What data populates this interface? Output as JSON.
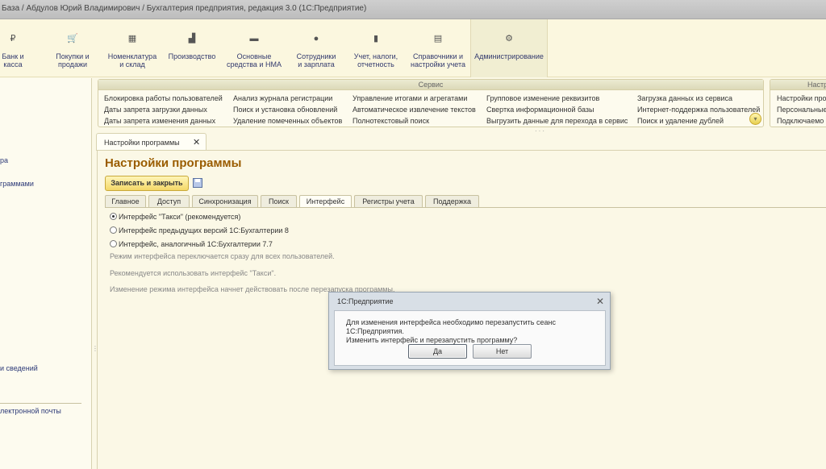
{
  "window": {
    "title": "База / Абдулов Юрий Владимирович / Бухгалтерия предприятия, редакция 3.0  (1С:Предприятие)"
  },
  "sections": [
    {
      "name": "bank",
      "line1": "Банк и",
      "line2": "касса",
      "icon": "ruble-icon",
      "glyph": "₽"
    },
    {
      "name": "purchases",
      "line1": "Покупки и",
      "line2": "продажи",
      "icon": "cart-icon",
      "glyph": "🛒"
    },
    {
      "name": "nomenclature",
      "line1": "Номенклатура",
      "line2": "и склад",
      "icon": "grid-icon",
      "glyph": "▦"
    },
    {
      "name": "production",
      "line1": "Производство",
      "line2": "",
      "icon": "factory-icon",
      "glyph": "▟"
    },
    {
      "name": "assets",
      "line1": "Основные",
      "line2": "средства и НМА",
      "icon": "truck-icon",
      "glyph": "▬"
    },
    {
      "name": "staff",
      "line1": "Сотрудники",
      "line2": "и зарплата",
      "icon": "person-icon",
      "glyph": "●"
    },
    {
      "name": "accounting",
      "line1": "Учет, налоги,",
      "line2": "отчетность",
      "icon": "chart-icon",
      "glyph": "▮"
    },
    {
      "name": "references",
      "line1": "Справочники и",
      "line2": "настройки учета",
      "icon": "books-icon",
      "glyph": "▤"
    },
    {
      "name": "admin",
      "line1": "Администрирование",
      "line2": "",
      "icon": "gear-icon",
      "glyph": "⚙"
    }
  ],
  "sidebar": {
    "items": [
      "ра",
      "граммами",
      "и сведений",
      "лектронной почты"
    ]
  },
  "service": {
    "title": "Сервис",
    "columns": [
      [
        "Блокировка работы пользователей",
        "Даты запрета загрузки данных",
        "Даты запрета изменения данных"
      ],
      [
        "Анализ журнала регистрации",
        "Поиск и установка обновлений",
        "Удаление помеченных объектов"
      ],
      [
        "Управление итогами и агрегатами",
        "Автоматическое извлечение текстов",
        "Полнотекстовый поиск"
      ],
      [
        "Групповое изменение реквизитов",
        "Свертка информационной базы",
        "Выгрузить данные для перехода в сервис"
      ],
      [
        "Загрузка данных из сервиса",
        "Интернет-поддержка пользователей",
        "Поиск и удаление дублей"
      ]
    ],
    "expand_glyph": "▾"
  },
  "settings_group": {
    "title": "Настр",
    "items": [
      "Настройки про",
      "Персональные",
      "Подключаемо"
    ]
  },
  "doc": {
    "tab_label": "Настройки программы",
    "close_glyph": "✕",
    "title": "Настройки программы",
    "save_close": "Записать и закрыть"
  },
  "tabs": [
    "Главное",
    "Доступ",
    "Синхронизация",
    "Поиск",
    "Интерфейс",
    "Регистры учета",
    "Поддержка"
  ],
  "interface": {
    "options": [
      {
        "label": "Интерфейс \"Такси\" (рекомендуется)",
        "checked": true
      },
      {
        "label": "Интерфейс предыдущих версий 1С:Бухгалтерии 8",
        "checked": false
      },
      {
        "label": "Интерфейс, аналогичный 1С:Бухгалтерии 7.7",
        "checked": false
      }
    ],
    "note1": "Режим интерфейса переключается сразу для всех пользователей.",
    "note2": "Рекомендуется использовать интерфейс \"Такси\".",
    "note3": "Изменение режима интерфейса начнет действовать после перезапуска программы."
  },
  "dialog": {
    "title": "1С:Предприятие",
    "close_glyph": "✕",
    "line1": "Для изменения интерфейса необходимо перезапустить сеанс 1С:Предприятия.",
    "line2": "Изменить интерфейс и перезапустить программу?",
    "yes": "Да",
    "no": "Нет"
  }
}
